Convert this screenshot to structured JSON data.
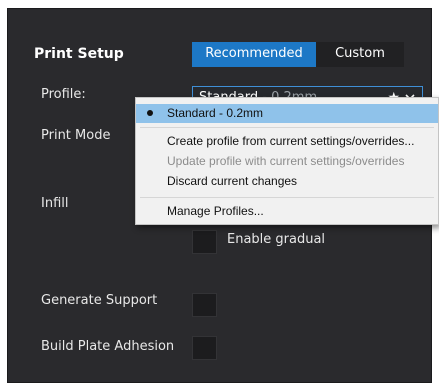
{
  "panel": {
    "title": "Print Setup",
    "tabs": [
      {
        "label": "Recommended",
        "active": true
      },
      {
        "label": "Custom",
        "active": false
      }
    ],
    "profile": {
      "label": "Profile:",
      "value_name": "Standard",
      "value_sub": " - 0.2mm",
      "icons": [
        "star-icon",
        "chevron-down-icon"
      ]
    },
    "settings": [
      "Print Mode",
      "Infill",
      "Generate Support",
      "Build Plate Adhesion"
    ],
    "gradual_label": "Enable gradual"
  },
  "menu": {
    "items": [
      {
        "label": "Standard - 0.2mm",
        "selected": true,
        "enabled": true
      },
      {
        "label": "Create profile from current settings/overrides...",
        "selected": false,
        "enabled": true
      },
      {
        "label": "Update profile with current settings/overrides",
        "selected": false,
        "enabled": false
      },
      {
        "label": "Discard current changes",
        "selected": false,
        "enabled": true
      },
      {
        "label": "Manage Profiles...",
        "selected": false,
        "enabled": true
      }
    ]
  },
  "colors": {
    "accent": "#1d78c6",
    "panel_bg": "#2a2a2d",
    "menu_highlight": "#8fc2ea"
  }
}
